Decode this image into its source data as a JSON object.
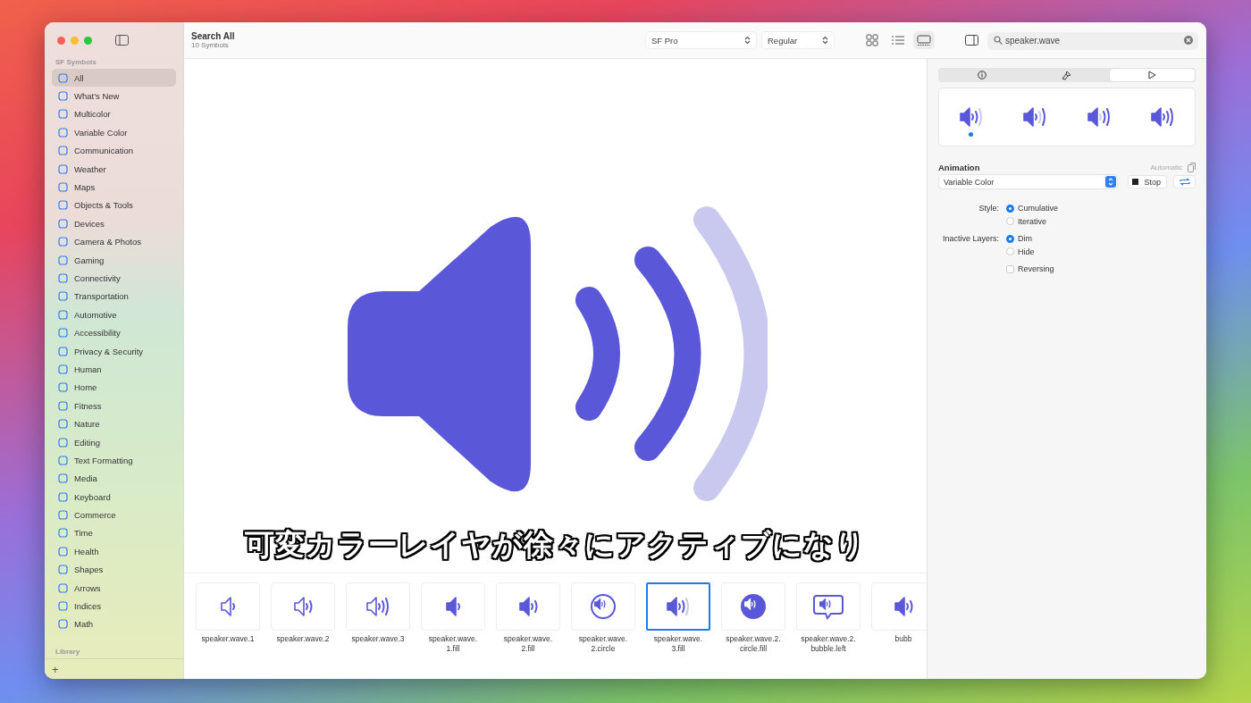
{
  "sidebar": {
    "section": "SF Symbols",
    "items": [
      {
        "label": "All",
        "selected": true
      },
      {
        "label": "What's New",
        "selected": false
      },
      {
        "label": "Multicolor",
        "selected": false
      },
      {
        "label": "Variable Color",
        "selected": false
      },
      {
        "label": "Communication",
        "selected": false
      },
      {
        "label": "Weather",
        "selected": false
      },
      {
        "label": "Maps",
        "selected": false
      },
      {
        "label": "Objects & Tools",
        "selected": false
      },
      {
        "label": "Devices",
        "selected": false
      },
      {
        "label": "Camera & Photos",
        "selected": false
      },
      {
        "label": "Gaming",
        "selected": false
      },
      {
        "label": "Connectivity",
        "selected": false
      },
      {
        "label": "Transportation",
        "selected": false
      },
      {
        "label": "Automotive",
        "selected": false
      },
      {
        "label": "Accessibility",
        "selected": false
      },
      {
        "label": "Privacy & Security",
        "selected": false
      },
      {
        "label": "Human",
        "selected": false
      },
      {
        "label": "Home",
        "selected": false
      },
      {
        "label": "Fitness",
        "selected": false
      },
      {
        "label": "Nature",
        "selected": false
      },
      {
        "label": "Editing",
        "selected": false
      },
      {
        "label": "Text Formatting",
        "selected": false
      },
      {
        "label": "Media",
        "selected": false
      },
      {
        "label": "Keyboard",
        "selected": false
      },
      {
        "label": "Commerce",
        "selected": false
      },
      {
        "label": "Time",
        "selected": false
      },
      {
        "label": "Health",
        "selected": false
      },
      {
        "label": "Shapes",
        "selected": false
      },
      {
        "label": "Arrows",
        "selected": false
      },
      {
        "label": "Indices",
        "selected": false
      },
      {
        "label": "Math",
        "selected": false
      }
    ],
    "library_section": "Library",
    "add_button": "+"
  },
  "toolbar": {
    "title": "Search All",
    "subtitle": "10 Symbols",
    "font": "SF Pro",
    "weight": "Regular",
    "views": [
      {
        "kind": "grid",
        "selected": false
      },
      {
        "kind": "list",
        "selected": false
      },
      {
        "kind": "gallery",
        "selected": true
      }
    ],
    "search": {
      "value": "speaker.wave"
    }
  },
  "preview": {
    "waves": [
      {
        "active": true
      },
      {
        "active": true
      },
      {
        "active": false
      }
    ]
  },
  "subtitle": "可変カラーレイヤが徐々にアクティブになり",
  "symbols": [
    {
      "kind": "wave1",
      "label": "speaker.wave.1",
      "selected": false
    },
    {
      "kind": "wave2",
      "label": "speaker.wave.2",
      "selected": false
    },
    {
      "kind": "wave3",
      "label": "speaker.wave.3",
      "selected": false
    },
    {
      "kind": "fill1",
      "label": "speaker.wave.\n1.fill",
      "selected": false
    },
    {
      "kind": "fill2",
      "label": "speaker.wave.\n2.fill",
      "selected": false
    },
    {
      "kind": "circle",
      "label": "speaker.wave.\n2.circle",
      "selected": false
    },
    {
      "kind": "fill3",
      "label": "speaker.wave.\n3.fill",
      "selected": true
    },
    {
      "kind": "circlefill",
      "label": "speaker.wave.2.\ncircle.fill",
      "selected": false
    },
    {
      "kind": "bubble",
      "label": "speaker.wave.2.\nbubble.left",
      "selected": false
    },
    {
      "kind": "fill2",
      "label": "bubb",
      "selected": false
    }
  ],
  "inspector": {
    "tabs": [
      {
        "kind": "info",
        "selected": false
      },
      {
        "kind": "brush",
        "selected": false
      },
      {
        "kind": "play",
        "selected": true
      }
    ],
    "previews": [
      {
        "selected": true
      },
      {
        "selected": false
      },
      {
        "selected": false
      },
      {
        "selected": false
      }
    ],
    "animation_label": "Animation",
    "automatic": "Automatic",
    "animation": "Variable Color",
    "stop": "Stop",
    "style_label": "Style:",
    "styles": [
      {
        "label": "Cumulative",
        "selected": true
      },
      {
        "label": "Iterative",
        "selected": false
      }
    ],
    "layers_label": "Inactive Layers:",
    "layers": [
      {
        "label": "Dim",
        "selected": true
      },
      {
        "label": "Hide",
        "selected": false
      }
    ],
    "reversing": {
      "label": "Reversing",
      "checked": false
    }
  }
}
